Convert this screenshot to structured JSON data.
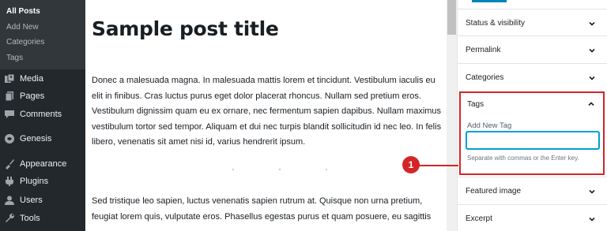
{
  "admin_menu": {
    "submenu": [
      "All Posts",
      "Add New",
      "Categories",
      "Tags"
    ],
    "current_submenu": "All Posts",
    "items": [
      {
        "label": "Media",
        "icon": "media-icon"
      },
      {
        "label": "Pages",
        "icon": "pages-icon"
      },
      {
        "label": "Comments",
        "icon": "comments-icon"
      },
      {
        "label": "Genesis",
        "icon": "genesis-icon"
      },
      {
        "label": "Appearance",
        "icon": "appearance-icon"
      },
      {
        "label": "Plugins",
        "icon": "plugins-icon"
      },
      {
        "label": "Users",
        "icon": "users-icon"
      },
      {
        "label": "Tools",
        "icon": "tools-icon"
      }
    ]
  },
  "editor": {
    "post_title": "Sample post title",
    "paragraph_1": "Donec a malesuada magna. In malesuada mattis lorem et tincidunt. Vestibulum iaculis eu elit in finibus. Cras luctus purus eget dolor placerat rhoncus. Nullam sed pretium eros. Vestibulum dignissim quam eu ex ornare, nec fermentum sapien dapibus. Nullam maximus vestibulum tortor sed tempor. Aliquam et dui nec turpis blandit sollicitudin id nec leo. In felis libero, venenatis sit amet nisi id, varius hendrerit ipsum.",
    "paragraph_2": "Sed tristique leo sapien, luctus venenatis sapien rutrum at. Quisque non urna pretium, feugiat lorem quis, vulputate eros. Phasellus egestas purus et quam posuere, eu sagittis"
  },
  "settings": {
    "panels_above": [
      {
        "title": "Status & visibility"
      },
      {
        "title": "Permalink"
      },
      {
        "title": "Categories"
      }
    ],
    "tags": {
      "title": "Tags",
      "field_label": "Add New Tag",
      "input_value": "",
      "help_text": "Separate with commas or the Enter key."
    },
    "panels_below": [
      {
        "title": "Featured image"
      },
      {
        "title": "Excerpt"
      }
    ]
  },
  "annotation": {
    "label": "1"
  },
  "colors": {
    "admin_bg": "#23282d",
    "submenu_bg": "#32373c",
    "accent_blue": "#0085ba",
    "focus_blue": "#00a0d2",
    "annotation_red": "#d42528"
  }
}
